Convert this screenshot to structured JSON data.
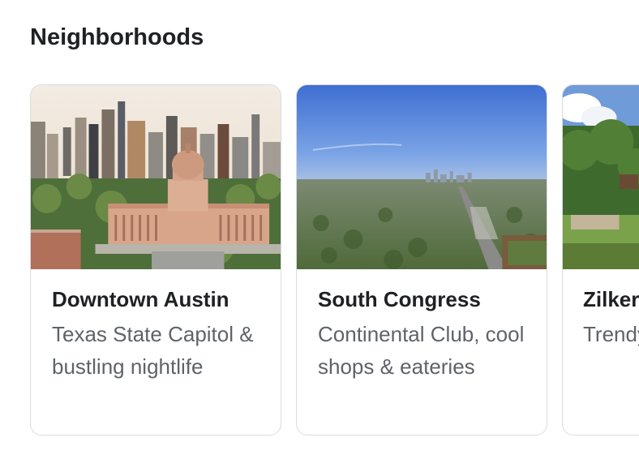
{
  "section": {
    "title": "Neighborhoods"
  },
  "cards": [
    {
      "title": "Downtown Austin",
      "desc": "Texas State Capitol & bustling nightlife",
      "image": "capitol-skyline-photo"
    },
    {
      "title": "South Congress",
      "desc": "Continental Club, cool shops & eateries",
      "image": "south-congress-aerial-photo"
    },
    {
      "title": "Zilker",
      "desc": "Trendy bars near Park",
      "image": "zilker-park-photo"
    }
  ],
  "colors": {
    "border": "#dadce0",
    "title": "#202124",
    "desc": "#5f6368"
  }
}
